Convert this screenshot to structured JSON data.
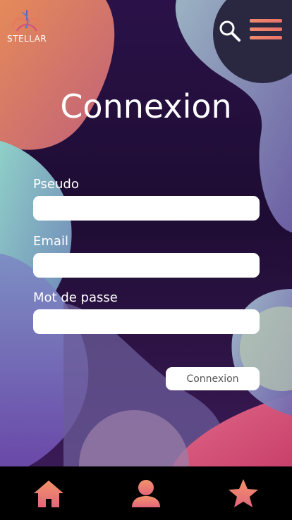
{
  "header": {
    "logo_text": "STELLAR",
    "search_icon": "search-icon",
    "menu_icon": "hamburger-menu-icon"
  },
  "page": {
    "title": "Connexion"
  },
  "form": {
    "fields": [
      {
        "label": "Pseudo",
        "value": "",
        "type": "text"
      },
      {
        "label": "Email",
        "value": "",
        "type": "email"
      },
      {
        "label": "Mot de passe",
        "value": "",
        "type": "password"
      }
    ],
    "submit_label": "Connexion"
  },
  "bottom_nav": {
    "items": [
      {
        "icon": "home-icon"
      },
      {
        "icon": "user-icon"
      },
      {
        "icon": "star-icon"
      }
    ]
  },
  "colors": {
    "background_dark": "#1e0c33",
    "accent_coral": "#f08a6c",
    "accent_pink": "#e8736a",
    "nav_background": "#000000",
    "input_background": "#ffffff"
  }
}
